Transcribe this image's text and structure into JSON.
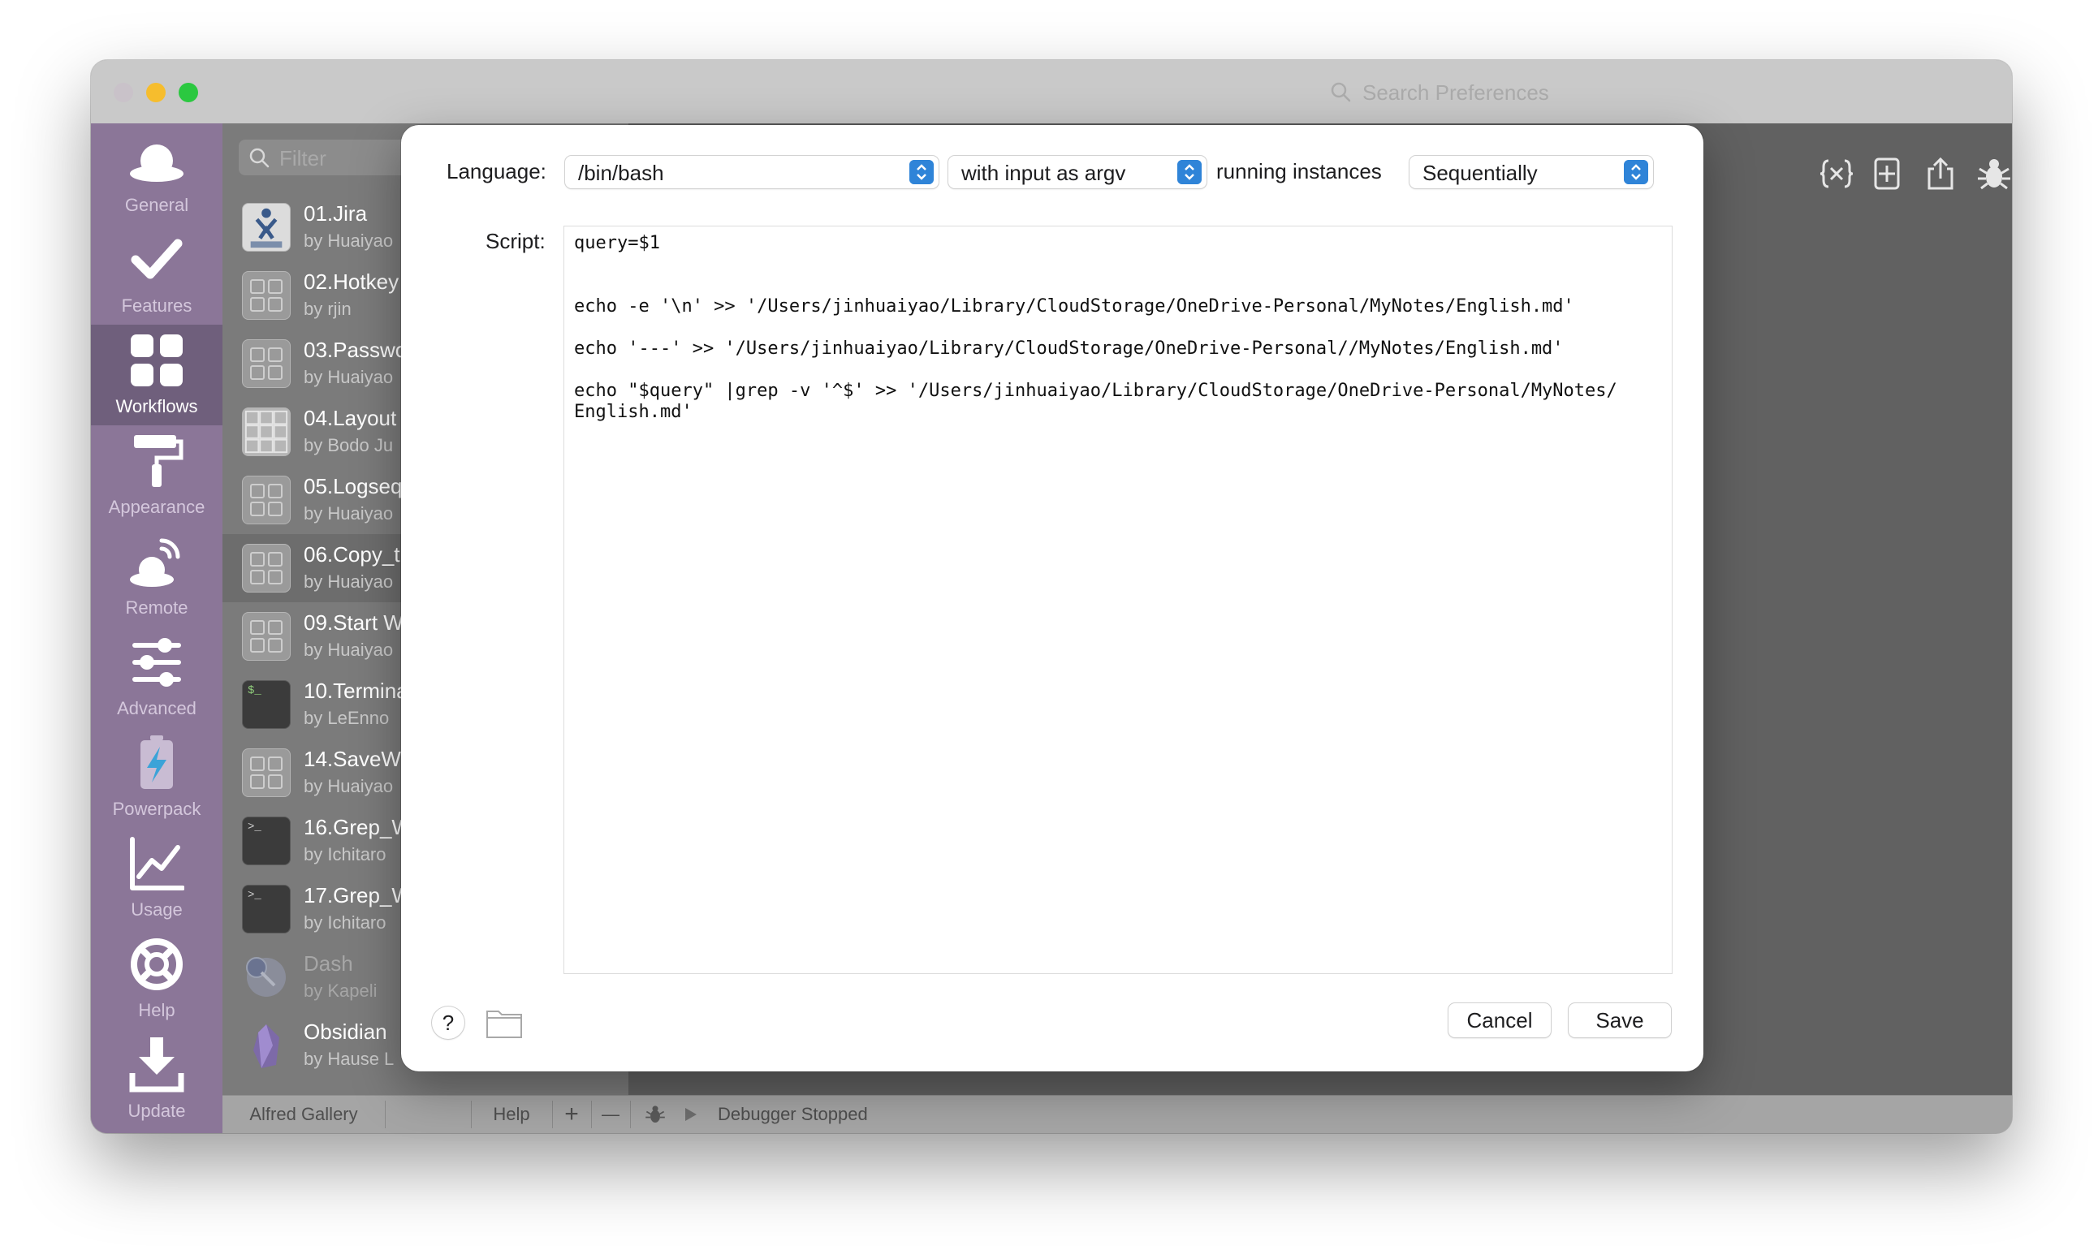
{
  "titlebar": {
    "search_placeholder": "Search Preferences"
  },
  "sidebar": {
    "items": [
      {
        "label": "General",
        "icon": "hat-icon"
      },
      {
        "label": "Features",
        "icon": "checkmark-icon"
      },
      {
        "label": "Workflows",
        "icon": "workflows-grid-icon"
      },
      {
        "label": "Appearance",
        "icon": "paint-roller-icon"
      },
      {
        "label": "Remote",
        "icon": "remote-hat-icon"
      },
      {
        "label": "Advanced",
        "icon": "sliders-icon"
      },
      {
        "label": "Powerpack",
        "icon": "battery-bolt-icon"
      },
      {
        "label": "Usage",
        "icon": "line-chart-icon"
      },
      {
        "label": "Help",
        "icon": "lifebuoy-icon"
      },
      {
        "label": "Update",
        "icon": "download-icon"
      }
    ],
    "selected": "Workflows"
  },
  "workflows": {
    "filter_placeholder": "Filter",
    "items": [
      {
        "title": "01.Jira",
        "author": "by Huaiyao"
      },
      {
        "title": "02.Hotkey",
        "author": "by rjin"
      },
      {
        "title": "03.Passwo",
        "author": "by Huaiyao"
      },
      {
        "title": "04.Layout",
        "author": "by Bodo Ju"
      },
      {
        "title": "05.Logseq",
        "author": "by Huaiyao"
      },
      {
        "title": "06.Copy_t",
        "author": "by Huaiyao"
      },
      {
        "title": "09.Start W",
        "author": "by Huaiyao"
      },
      {
        "title": "10.Termina",
        "author": "by LeEnno"
      },
      {
        "title": "14.SaveW",
        "author": "by Huaiyao"
      },
      {
        "title": "16.Grep_W",
        "author": "by Ichitaro"
      },
      {
        "title": "17.Grep_W",
        "author": "by Ichitaro"
      },
      {
        "title": "Dash",
        "author": "by Kapeli"
      },
      {
        "title": "Obsidian",
        "author": "by Hause L"
      }
    ]
  },
  "bottombar": {
    "gallery": "Alfred Gallery",
    "help": "Help",
    "add": "+",
    "remove": "—",
    "debugger_status": "Debugger Stopped"
  },
  "dialog": {
    "language_label": "Language:",
    "language_value": "/bin/bash",
    "input_mode_value": "with input as argv",
    "running_label": "running instances",
    "running_value": "Sequentially",
    "script_label": "Script:",
    "script_lines": [
      "query=$1",
      "echo -e '\\n' >> '/Users/jinhuaiyao/Library/CloudStorage/OneDrive-Personal/MyNotes/English.md'",
      "echo '---' >> '/Users/jinhuaiyao/Library/CloudStorage/OneDrive-Personal//MyNotes/English.md'",
      "echo \"$query\" |grep -v '^$' >> '/Users/jinhuaiyao/Library/CloudStorage/OneDrive-Personal/MyNotes/",
      "English.md'"
    ],
    "help_label": "?",
    "cancel_label": "Cancel",
    "save_label": "Save"
  },
  "colors": {
    "sidebar": "#8b7698",
    "sidebar_selected": "#6f5f7c",
    "popup_accent": "#2f84d8"
  }
}
